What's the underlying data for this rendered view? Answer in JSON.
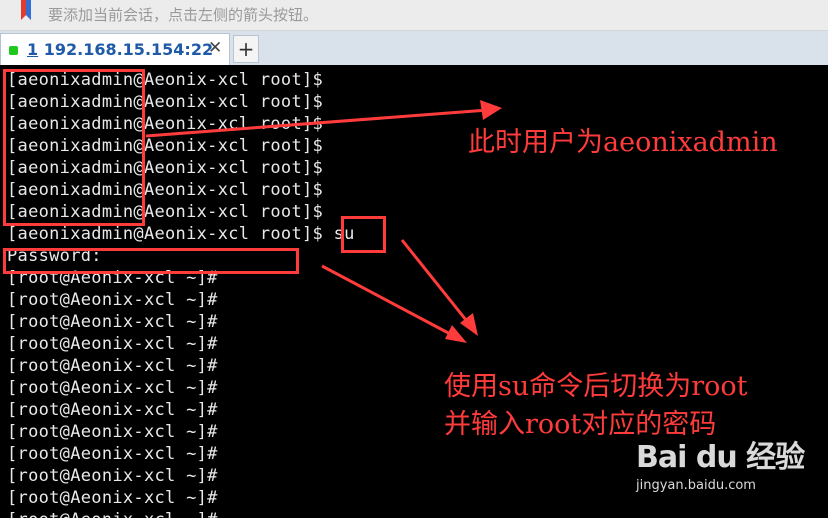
{
  "topbar": {
    "hint": "要添加当前会话，点击左侧的箭头按钮。"
  },
  "tab": {
    "number": "1",
    "title": "192.168.15.154:22",
    "close_label": "✕",
    "add_label": "+"
  },
  "terminal": {
    "lines": [
      "[aeonixadmin@Aeonix-xcl root]$",
      "[aeonixadmin@Aeonix-xcl root]$",
      "[aeonixadmin@Aeonix-xcl root]$",
      "[aeonixadmin@Aeonix-xcl root]$",
      "[aeonixadmin@Aeonix-xcl root]$",
      "[aeonixadmin@Aeonix-xcl root]$",
      "[aeonixadmin@Aeonix-xcl root]$",
      "[aeonixadmin@Aeonix-xcl root]$ su",
      "Password:",
      "[root@Aeonix-xcl ~]#",
      "[root@Aeonix-xcl ~]#",
      "[root@Aeonix-xcl ~]#",
      "[root@Aeonix-xcl ~]#",
      "[root@Aeonix-xcl ~]#",
      "[root@Aeonix-xcl ~]#",
      "[root@Aeonix-xcl ~]#",
      "[root@Aeonix-xcl ~]#",
      "[root@Aeonix-xcl ~]#",
      "[root@Aeonix-xcl ~]#",
      "[root@Aeonix-xcl ~]#",
      "[root@Aeonix-xcl ~]#"
    ]
  },
  "annotations": {
    "user_note": "此时用户为aeonixadmin",
    "su_note_line1": "使用su命令后切换为root",
    "su_note_line2": "并输入root对应的密码",
    "color": "#ff3b3b"
  },
  "watermark": {
    "logo": "Bai du 经验",
    "url": "jingyan.baidu.com"
  }
}
